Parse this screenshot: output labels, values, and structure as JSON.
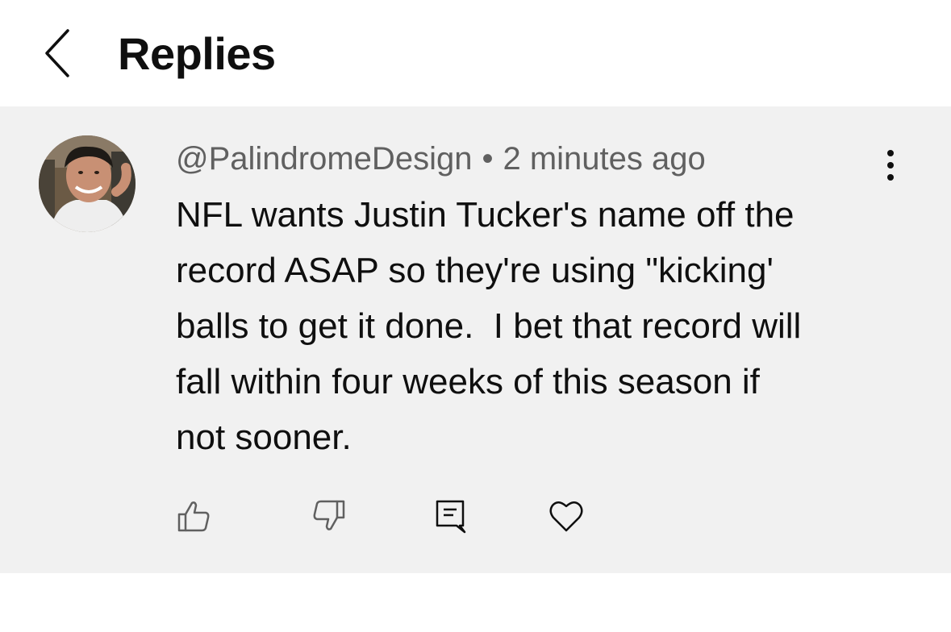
{
  "header": {
    "title": "Replies",
    "back_icon": "chevron-left-icon"
  },
  "comment": {
    "username": "@PalindromeDesign",
    "separator": "•",
    "timestamp": "2 minutes ago",
    "text": "NFL wants Justin Tucker's name off the\nrecord ASAP so they're using \"kicking'\nballs to get it done.  I bet that record will\nfall within four weeks of this season if\nnot sooner.",
    "avatar_icon": "user-avatar",
    "menu_icon": "more-vertical-icon"
  },
  "actions": [
    {
      "name": "like",
      "icon": "thumbs-up-icon"
    },
    {
      "name": "dislike",
      "icon": "thumbs-down-icon"
    },
    {
      "name": "reply",
      "icon": "comment-icon"
    },
    {
      "name": "heart",
      "icon": "heart-icon"
    }
  ],
  "colors": {
    "background": "#ffffff",
    "comment_background": "#f1f1f1",
    "text": "#0f0f0f",
    "meta_text": "#606060",
    "icon": "#606060"
  }
}
